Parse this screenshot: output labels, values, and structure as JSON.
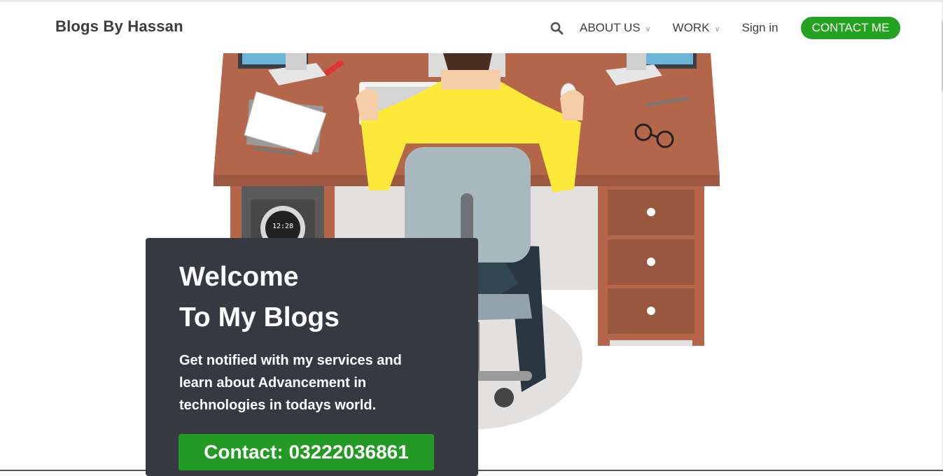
{
  "header": {
    "brand": "Blogs By Hassan",
    "nav": [
      {
        "label": "ABOUT US",
        "has_dropdown": true
      },
      {
        "label": "WORK",
        "has_dropdown": true
      },
      {
        "label": "Sign in",
        "has_dropdown": false
      }
    ],
    "contact_label": "CONTACT ME",
    "search_icon": "search-icon",
    "chevron_icon": "chevron-down-icon"
  },
  "hero": {
    "title_line1": "Welcome",
    "title_line2": "To My Blogs",
    "description": "Get notified with my services and learn about Advancement in technologies in todays world.",
    "button_label": "Contact: 03222036861",
    "clock_text": "12:28",
    "illustration": "person-at-desk-illustration"
  },
  "colors": {
    "accent_green": "#23a31f",
    "card_bg": "#363940",
    "desk": "#b4664b",
    "shirt": "#fce93a",
    "chair": "#a9b7bf"
  }
}
